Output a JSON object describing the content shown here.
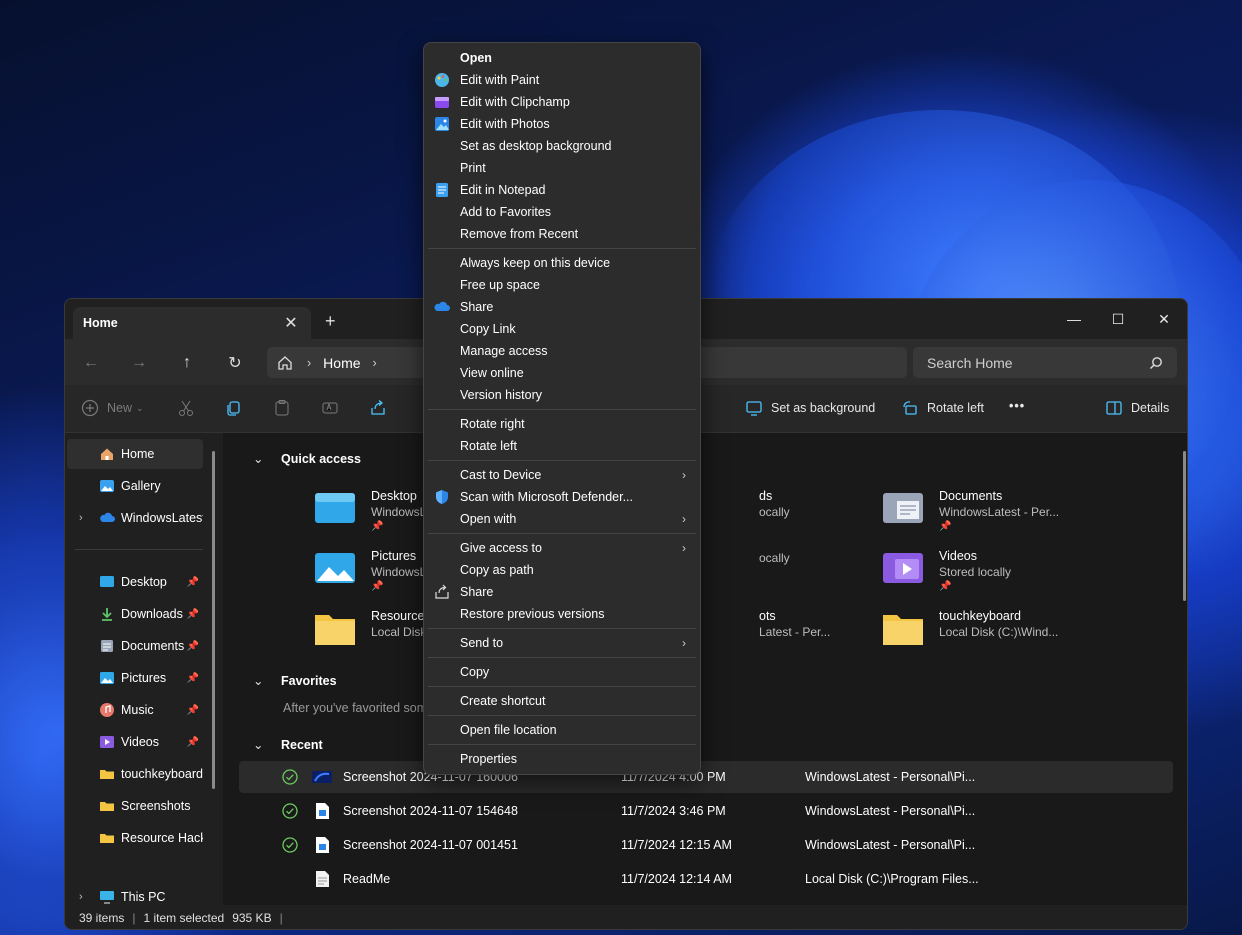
{
  "window": {
    "tab_title": "Home",
    "tab_close": "✕",
    "tab_add": "+",
    "minimize": "—",
    "maximize": "☐",
    "close": "✕"
  },
  "navbar": {
    "back": "←",
    "forward": "→",
    "up": "↑",
    "refresh": "↻",
    "breadcrumb": [
      "Home"
    ],
    "search_placeholder": "Search Home"
  },
  "toolbar": {
    "new_label": "New",
    "set_bg_label": "Set as background",
    "rotate_left_label": "Rotate left",
    "more_label": "•••",
    "details_label": "Details"
  },
  "sidebar": {
    "top": [
      {
        "label": "Home",
        "icon": "home-icon"
      },
      {
        "label": "Gallery",
        "icon": "gallery-icon"
      },
      {
        "label": "WindowsLatest",
        "icon": "onedrive-icon"
      }
    ],
    "pinned": [
      {
        "label": "Desktop",
        "icon": "desktop-icon"
      },
      {
        "label": "Downloads",
        "icon": "downloads-icon"
      },
      {
        "label": "Documents",
        "icon": "documents-icon"
      },
      {
        "label": "Pictures",
        "icon": "pictures-icon"
      },
      {
        "label": "Music",
        "icon": "music-icon"
      },
      {
        "label": "Videos",
        "icon": "videos-icon"
      }
    ],
    "folders": [
      {
        "label": "touchkeyboard"
      },
      {
        "label": "Screenshots"
      },
      {
        "label": "Resource Hacke"
      }
    ],
    "this_pc": "This PC"
  },
  "content": {
    "quick_access_title": "Quick access",
    "favorites_title": "Favorites",
    "favorites_hint": "After you've favorited some",
    "recent_title": "Recent",
    "quick_access": [
      {
        "name": "Desktop",
        "sub": "WindowsL",
        "pinned": true
      },
      {
        "name": "Pictures",
        "sub": "WindowsL",
        "pinned": true
      },
      {
        "name": "Resource I",
        "sub": "Local Disk",
        "pinned": false
      },
      {
        "name": "ds",
        "sub": "ocally",
        "pinned": false
      },
      {
        "name": "",
        "sub": "ocally",
        "pinned": false
      },
      {
        "name": "ots",
        "sub": "Latest - Per...",
        "pinned": false
      },
      {
        "name": "Documents",
        "sub": "WindowsLatest - Per...",
        "pinned": true
      },
      {
        "name": "Videos",
        "sub": "Stored locally",
        "pinned": true
      },
      {
        "name": "touchkeyboard",
        "sub": "Local Disk (C:)\\Wind...",
        "pinned": false
      }
    ],
    "recent": [
      {
        "name": "Screenshot 2024-11-07 160006",
        "date": "11/7/2024 4:00 PM",
        "location": "WindowsLatest - Personal\\Pi..."
      },
      {
        "name": "Screenshot 2024-11-07 154648",
        "date": "11/7/2024 3:46 PM",
        "location": "WindowsLatest - Personal\\Pi..."
      },
      {
        "name": "Screenshot 2024-11-07 001451",
        "date": "11/7/2024 12:15 AM",
        "location": "WindowsLatest - Personal\\Pi..."
      },
      {
        "name": "ReadMe",
        "date": "11/7/2024 12:14 AM",
        "location": "Local Disk (C:)\\Program Files..."
      }
    ]
  },
  "status": {
    "items": "39 items",
    "selected": "1 item selected",
    "size": "935 KB"
  },
  "context_menu": {
    "groups": [
      [
        {
          "label": "Open",
          "bold": true
        },
        {
          "label": "Edit with Paint",
          "icon": "paint-icon"
        },
        {
          "label": "Edit with Clipchamp",
          "icon": "clipchamp-icon"
        },
        {
          "label": "Edit with Photos",
          "icon": "photos-icon"
        },
        {
          "label": "Set as desktop background"
        },
        {
          "label": "Print"
        },
        {
          "label": "Edit in Notepad",
          "icon": "notepad-icon"
        },
        {
          "label": "Add to Favorites"
        },
        {
          "label": "Remove from Recent"
        }
      ],
      [
        {
          "label": "Always keep on this device"
        },
        {
          "label": "Free up space"
        },
        {
          "label": "Share",
          "icon": "onedrive-icon"
        },
        {
          "label": "Copy Link"
        },
        {
          "label": "Manage access"
        },
        {
          "label": "View online"
        },
        {
          "label": "Version history"
        }
      ],
      [
        {
          "label": "Rotate right"
        },
        {
          "label": "Rotate left"
        }
      ],
      [
        {
          "label": "Cast to Device",
          "submenu": true
        },
        {
          "label": "Scan with Microsoft Defender...",
          "icon": "defender-icon"
        },
        {
          "label": "Open with",
          "submenu": true
        }
      ],
      [
        {
          "label": "Give access to",
          "submenu": true
        },
        {
          "label": "Copy as path"
        },
        {
          "label": "Share",
          "icon": "share-icon"
        },
        {
          "label": "Restore previous versions"
        }
      ],
      [
        {
          "label": "Send to",
          "submenu": true
        }
      ],
      [
        {
          "label": "Copy"
        }
      ],
      [
        {
          "label": "Create shortcut"
        }
      ],
      [
        {
          "label": "Open file location"
        }
      ],
      [
        {
          "label": "Properties"
        }
      ]
    ]
  },
  "colors": {
    "accent": "#4cc2ff",
    "folder": "#f4c542",
    "check": "#6ccb5f"
  }
}
